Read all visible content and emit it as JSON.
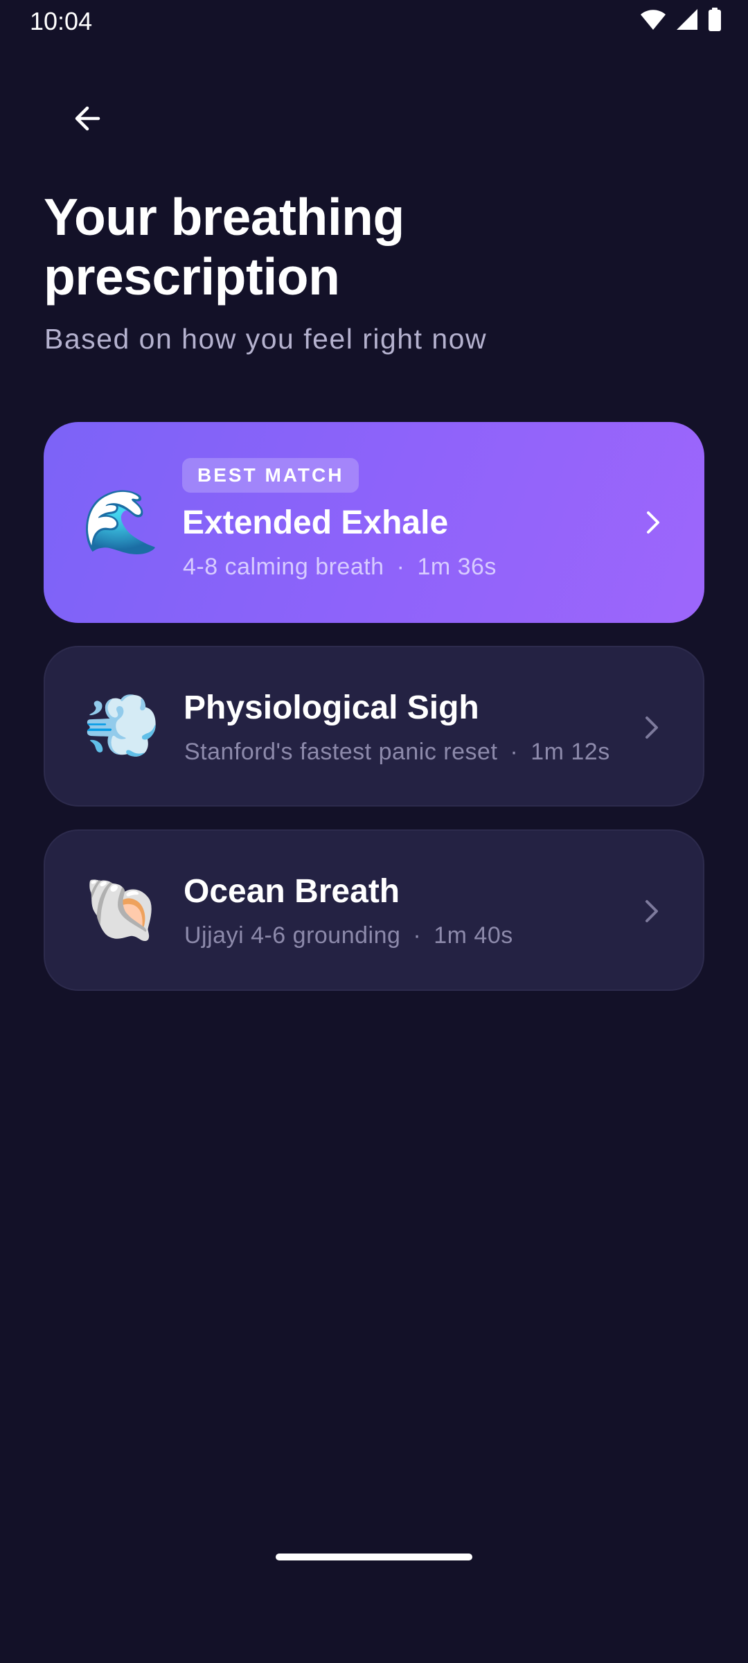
{
  "status_bar": {
    "time": "10:04"
  },
  "header": {
    "title": "Your breathing prescription",
    "subtitle": "Based on how you feel right now"
  },
  "exercises": [
    {
      "emoji": "🌊",
      "badge": "BEST MATCH",
      "title": "Extended Exhale",
      "description": "4-8 calming breath",
      "separator": "·",
      "duration": "1m 36s",
      "featured": true
    },
    {
      "emoji": "💨",
      "title": "Physiological Sigh",
      "description": "Stanford's fastest panic reset",
      "separator": "·",
      "duration": "1m 12s",
      "featured": false
    },
    {
      "emoji": "🐚",
      "title": "Ocean Breath",
      "description": "Ujjayi 4-6 grounding",
      "separator": "·",
      "duration": "1m 40s",
      "featured": false
    }
  ],
  "colors": {
    "background": "#131128",
    "card": "#242243",
    "featured_gradient_start": "#7c63f7",
    "featured_gradient_end": "#9d66fb"
  }
}
